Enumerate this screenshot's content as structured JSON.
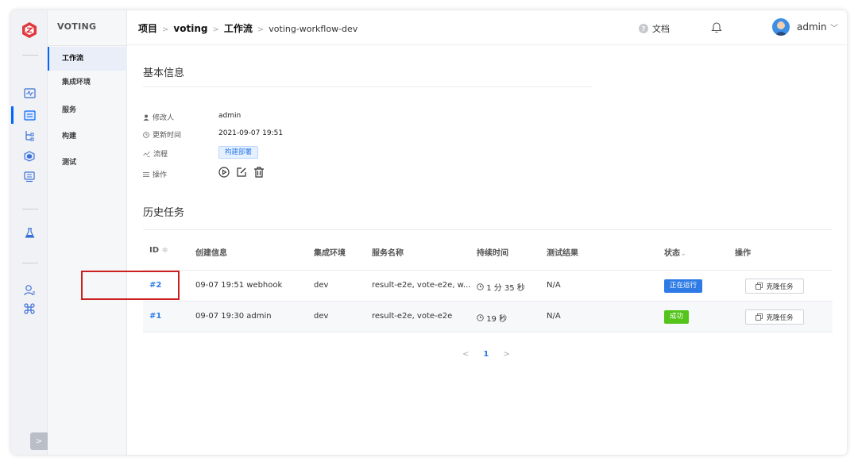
{
  "app": {
    "logo_icon": "zadig-logo-icon",
    "accent": "#0066ff"
  },
  "rail": {
    "icons": [
      "monitor-icon",
      "folder-icon",
      "tree-icon",
      "cube-icon",
      "deploy-icon",
      "flask-icon",
      "user-manage-icon",
      "command-icon"
    ],
    "collapse_glyph": ">"
  },
  "project_menu": {
    "title": "VOTING",
    "items": [
      {
        "label": "工作流",
        "active": true
      },
      {
        "label": "集成环境"
      },
      {
        "label": "服务"
      },
      {
        "label": "构建"
      },
      {
        "label": "测试"
      }
    ]
  },
  "breadcrumb": {
    "items": [
      "项目",
      "voting",
      "工作流",
      "voting-workflow-dev"
    ],
    "sep": ">"
  },
  "header": {
    "docs_label": "文档",
    "help_glyph": "?",
    "user_name": "admin",
    "chevron": "﹀"
  },
  "basic_info": {
    "title": "基本信息",
    "rows": [
      {
        "label": "修改人",
        "icon": "user-icon",
        "value": "admin"
      },
      {
        "label": "更新时间",
        "icon": "clock-icon",
        "value": "2021-09-07 19:51"
      },
      {
        "label": "流程",
        "icon": "flow-icon",
        "tag": "构建部署"
      },
      {
        "label": "操作",
        "icon": "settings-icon"
      }
    ]
  },
  "history": {
    "title": "历史任务",
    "columns": [
      "ID",
      "创建信息",
      "集成环境",
      "服务名称",
      "持续时间",
      "测试结果",
      "状态",
      "操作"
    ],
    "sort_glyph": "≑",
    "filter_glyph": "⌄",
    "rows": [
      {
        "id": "#2",
        "created": "09-07 19:51 webhook",
        "env": "dev",
        "services": "result-e2e, vote-e2e, w...",
        "duration": "1 分 35 秒",
        "test": "N/A",
        "status": "正在运行",
        "status_color": "#2f7be6",
        "action": "克隆任务"
      },
      {
        "id": "#1",
        "created": "09-07 19:30 admin",
        "env": "dev",
        "services": "result-e2e, vote-e2e",
        "duration": "19 秒",
        "test": "N/A",
        "status": "成功",
        "status_color": "#52c41a",
        "action": "克隆任务"
      }
    ]
  },
  "pagination": {
    "prev": "<",
    "current": "1",
    "next": ">"
  }
}
